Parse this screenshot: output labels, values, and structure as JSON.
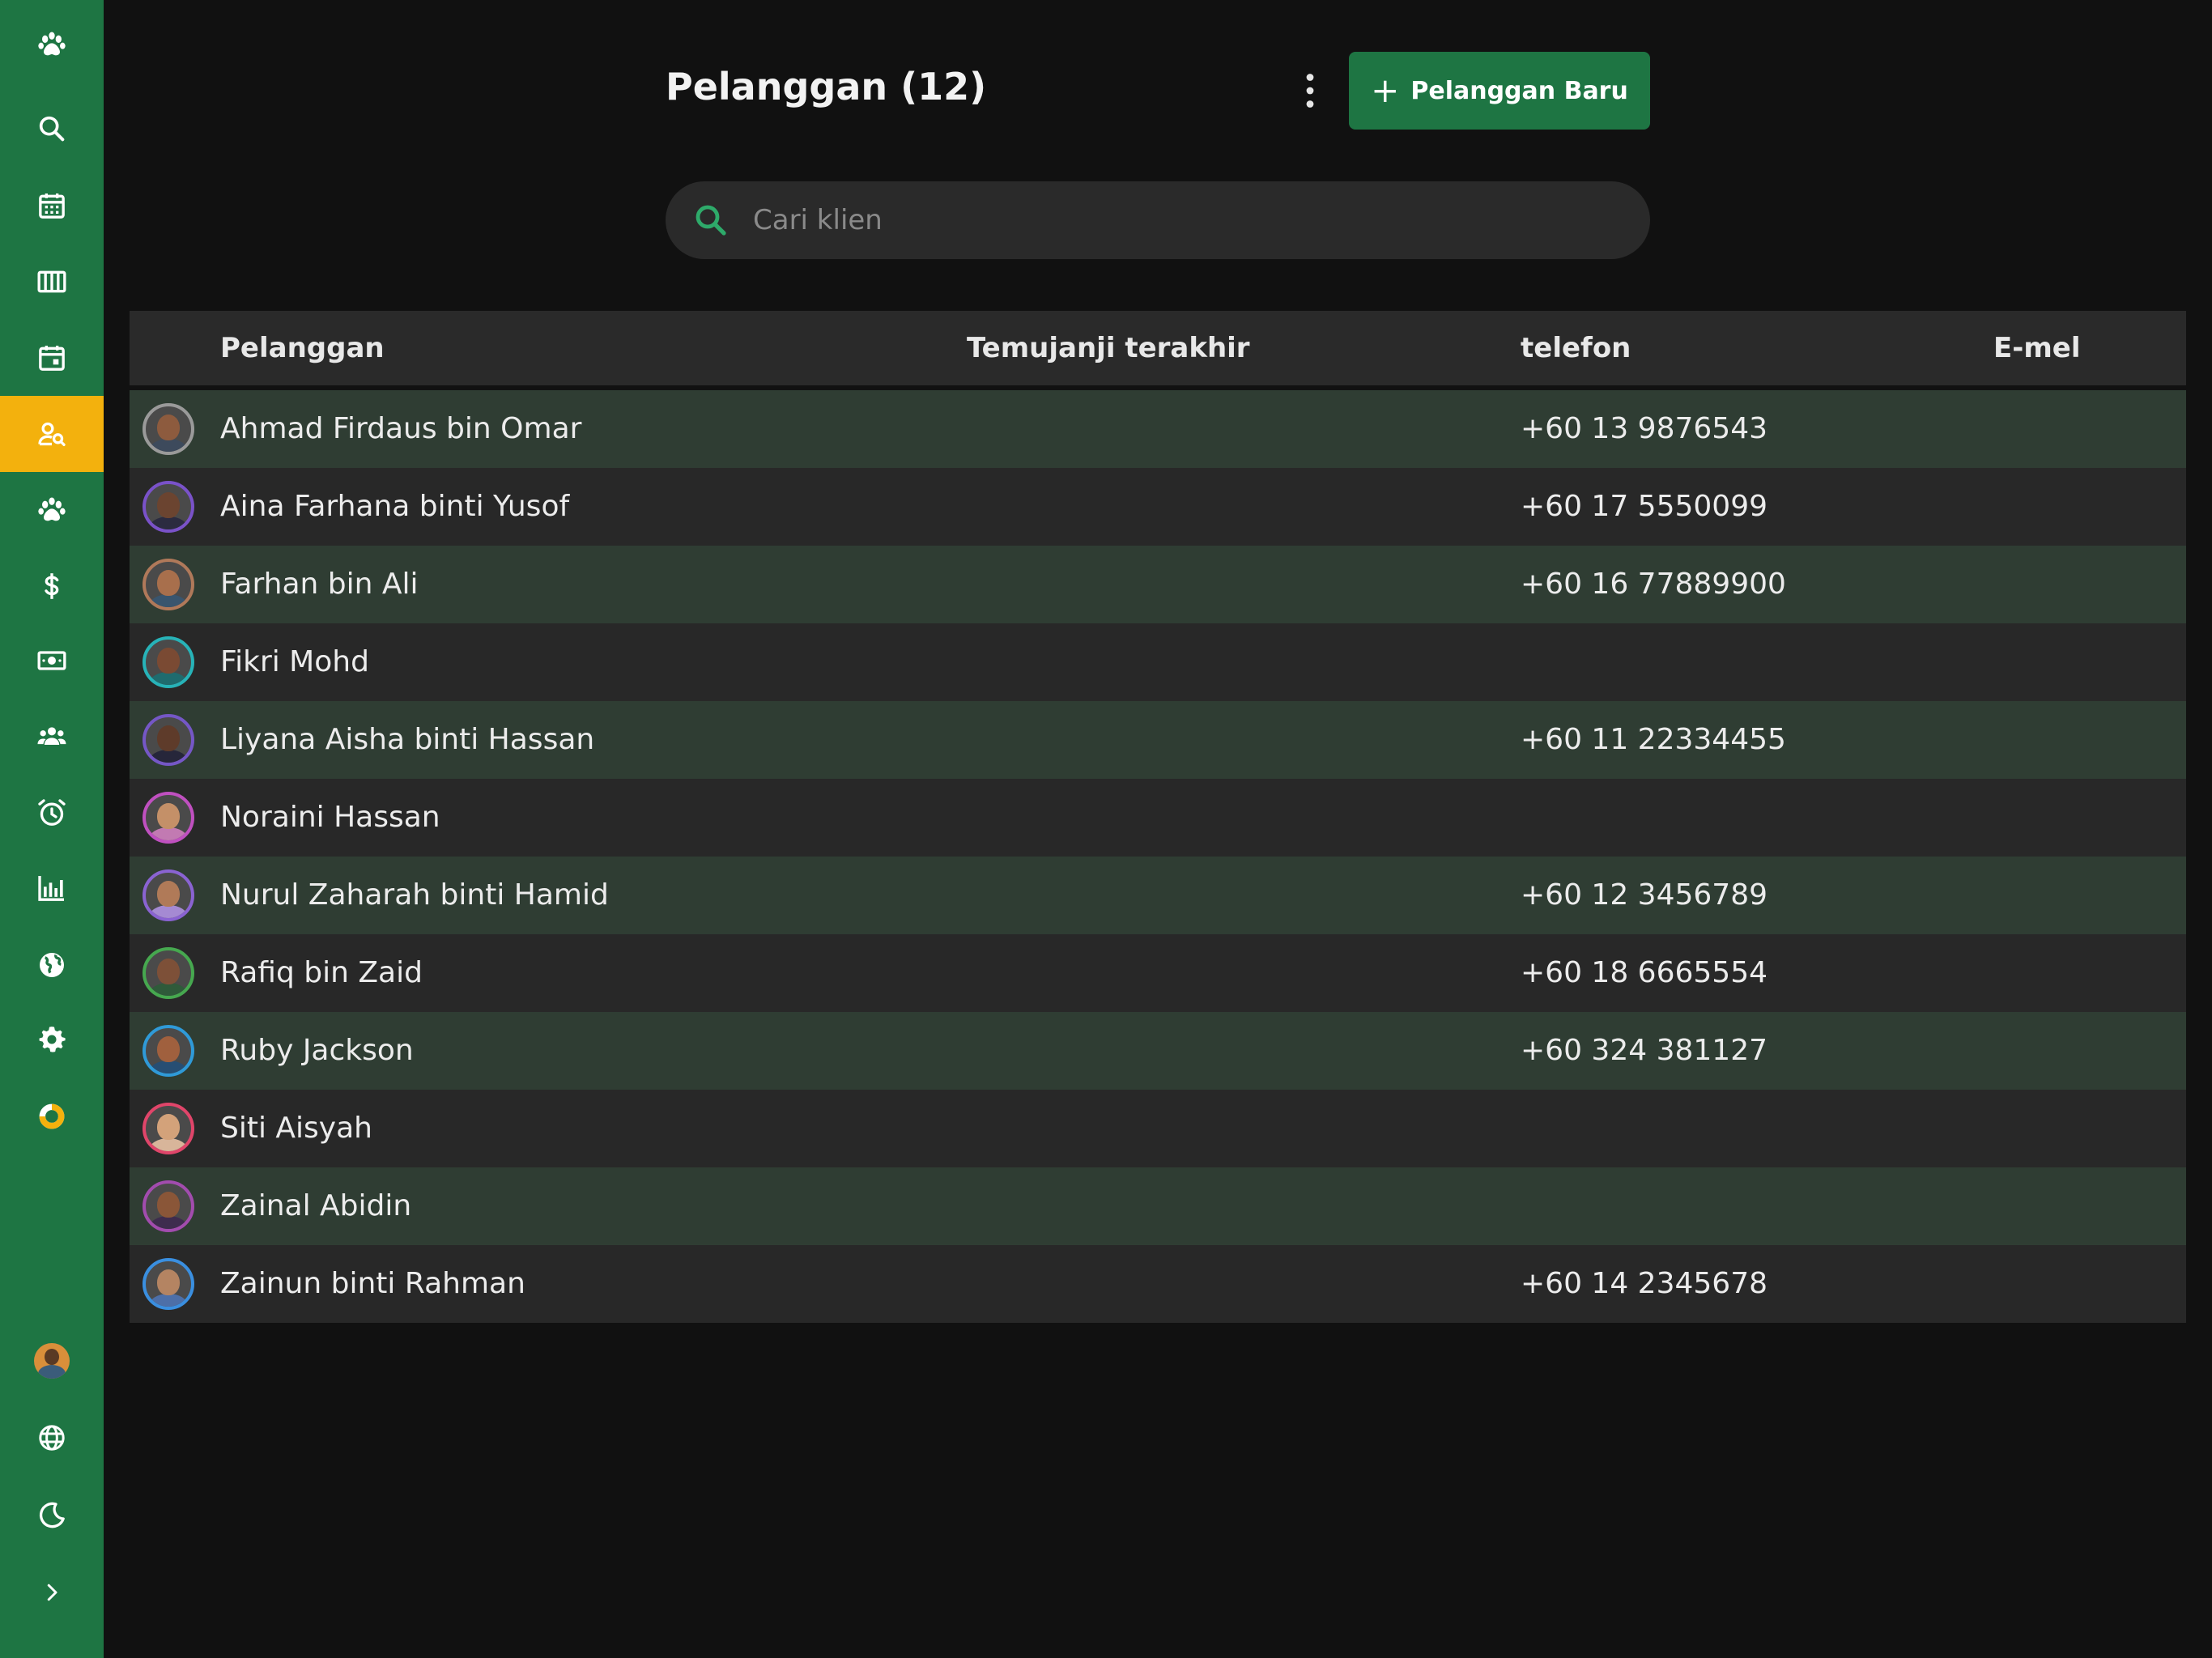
{
  "sidebar": {
    "items": [
      {
        "name": "paw-icon"
      },
      {
        "name": "search-icon"
      },
      {
        "name": "calendar-icon"
      },
      {
        "name": "columns-icon"
      },
      {
        "name": "calendar-day-icon"
      },
      {
        "name": "customer-search-icon",
        "active": true
      },
      {
        "name": "paw-icon"
      },
      {
        "name": "dollar-icon"
      },
      {
        "name": "money-icon"
      },
      {
        "name": "team-icon"
      },
      {
        "name": "alarm-icon"
      },
      {
        "name": "bar-chart-icon"
      },
      {
        "name": "globe-icon"
      },
      {
        "name": "gear-icon"
      },
      {
        "name": "ring-icon"
      }
    ],
    "bottom": [
      {
        "name": "user-avatar"
      },
      {
        "name": "language-globe-icon"
      },
      {
        "name": "moon-icon"
      },
      {
        "name": "chevron-right-icon"
      }
    ],
    "active_color": "#f3b10d",
    "bg_color": "#1e7543"
  },
  "header": {
    "title": "Pelanggan (12)",
    "new_button_label": "Pelanggan Baru",
    "new_button_icon": "plus-icon",
    "more_icon": "vertical-dots-icon"
  },
  "search": {
    "placeholder": "Cari klien",
    "value": ""
  },
  "table": {
    "columns": [
      "Pelanggan",
      "Temujanji terakhir",
      "telefon",
      "E-mel"
    ],
    "rows": [
      {
        "name": "Ahmad Firdaus bin Omar",
        "last_appointment": "",
        "phone": "+60 13 9876543",
        "email": "",
        "ring": "#9a9a9a"
      },
      {
        "name": "Aina Farhana binti Yusof",
        "last_appointment": "",
        "phone": "+60 17 5550099",
        "email": "",
        "ring": "#7a52c9"
      },
      {
        "name": "Farhan bin Ali",
        "last_appointment": "",
        "phone": "+60 16 77889900",
        "email": "",
        "ring": "#b0795a"
      },
      {
        "name": "Fikri Mohd",
        "last_appointment": "",
        "phone": "",
        "email": "",
        "ring": "#27b3b8"
      },
      {
        "name": "Liyana Aisha binti Hassan",
        "last_appointment": "",
        "phone": "+60 11 22334455",
        "email": "",
        "ring": "#7557c6"
      },
      {
        "name": "Noraini Hassan",
        "last_appointment": "",
        "phone": "",
        "email": "",
        "ring": "#c050c0"
      },
      {
        "name": "Nurul Zaharah binti Hamid",
        "last_appointment": "",
        "phone": "+60 12 3456789",
        "email": "",
        "ring": "#8a63d2"
      },
      {
        "name": "Rafiq bin Zaid",
        "last_appointment": "",
        "phone": "+60 18 6665554",
        "email": "",
        "ring": "#46a84f"
      },
      {
        "name": "Ruby Jackson",
        "last_appointment": "",
        "phone": "+60 324 381127",
        "email": "",
        "ring": "#2f9ad8"
      },
      {
        "name": "Siti Aisyah",
        "last_appointment": "",
        "phone": "",
        "email": "",
        "ring": "#e0456a"
      },
      {
        "name": "Zainal Abidin",
        "last_appointment": "",
        "phone": "",
        "email": "",
        "ring": "#a24cae"
      },
      {
        "name": "Zainun binti Rahman",
        "last_appointment": "",
        "phone": "+60 14 2345678",
        "email": "",
        "ring": "#3a8fe0"
      }
    ],
    "even_row_color": "#2f3d33",
    "odd_row_color": "#282828"
  }
}
